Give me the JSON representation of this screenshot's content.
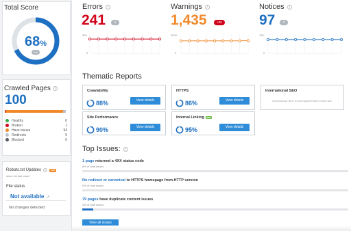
{
  "total_score": {
    "title": "Total Score",
    "value": "68",
    "unit": "%",
    "badge": "0%",
    "fraction": 0.68,
    "color": "#1e70c2"
  },
  "crawled": {
    "title": "Crawled Pages",
    "count": "100",
    "legend": [
      {
        "label": "Healthy",
        "count": "0",
        "color": "#3daa4a"
      },
      {
        "label": "Broken",
        "count": "1",
        "color": "#d0021b"
      },
      {
        "label": "Have issues",
        "count": "94",
        "color": "#f08a2b"
      },
      {
        "label": "Redirects",
        "count": "5",
        "color": "#b9c2cc"
      },
      {
        "label": "Blocked",
        "count": "0",
        "color": "#545b64"
      }
    ]
  },
  "robots": {
    "title": "Robots.txt Updates",
    "badge": "new",
    "subtitle": "since the last crawl",
    "status_label": "File status",
    "status_value": "Not available",
    "changes": "No changes detected"
  },
  "metrics": {
    "errors": {
      "title": "Errors",
      "value": "241",
      "badge": "0",
      "color": "#d0021b",
      "ymax": "300",
      "ymin": "0",
      "series": [
        241,
        241,
        241,
        241,
        241,
        241,
        241,
        241,
        241
      ]
    },
    "warnings": {
      "title": "Warnings",
      "value": "1,435",
      "badge": "+35",
      "color": "#f08a2b",
      "ymax": "2000",
      "ymin": "0",
      "series": [
        1400,
        1400,
        1400,
        1400,
        1400,
        1400,
        1400,
        1400,
        1435
      ]
    },
    "notices": {
      "title": "Notices",
      "value": "97",
      "badge": "0",
      "color": "#1e70c2",
      "ymax": "125",
      "ymin": "0",
      "series": [
        97,
        97,
        97,
        97,
        97,
        97,
        97,
        97,
        97
      ]
    }
  },
  "thematic": {
    "title": "Thematic Reports",
    "button_label": "View details",
    "cards": [
      {
        "name": "Crawlability",
        "value": "88%",
        "pct": 0.88
      },
      {
        "name": "HTTPS",
        "value": "86%",
        "pct": 0.86
      },
      {
        "name": "International SEO",
        "note": "International SEO is not implemented on this site."
      },
      {
        "name": "Site Performance",
        "value": "90%",
        "pct": 0.9
      },
      {
        "name": "Internal Linking",
        "badge": "new",
        "value": "95%",
        "pct": 0.95
      }
    ]
  },
  "top_issues": {
    "title": "Top Issues:",
    "items": [
      {
        "link": "1 page",
        "text": " returned a 4XX status code",
        "sub": "8% of total issues",
        "fraction": 0.0
      },
      {
        "link": "No redirect or canonical",
        "text": " to HTTPS homepage from HTTP version",
        "sub": "0% of total issues",
        "fraction": 0.0
      },
      {
        "link": "79 pages",
        "text": " have duplicate content issues",
        "sub": "4% of total issues",
        "fraction": 0.04
      }
    ],
    "view_all": "View all issues"
  }
}
